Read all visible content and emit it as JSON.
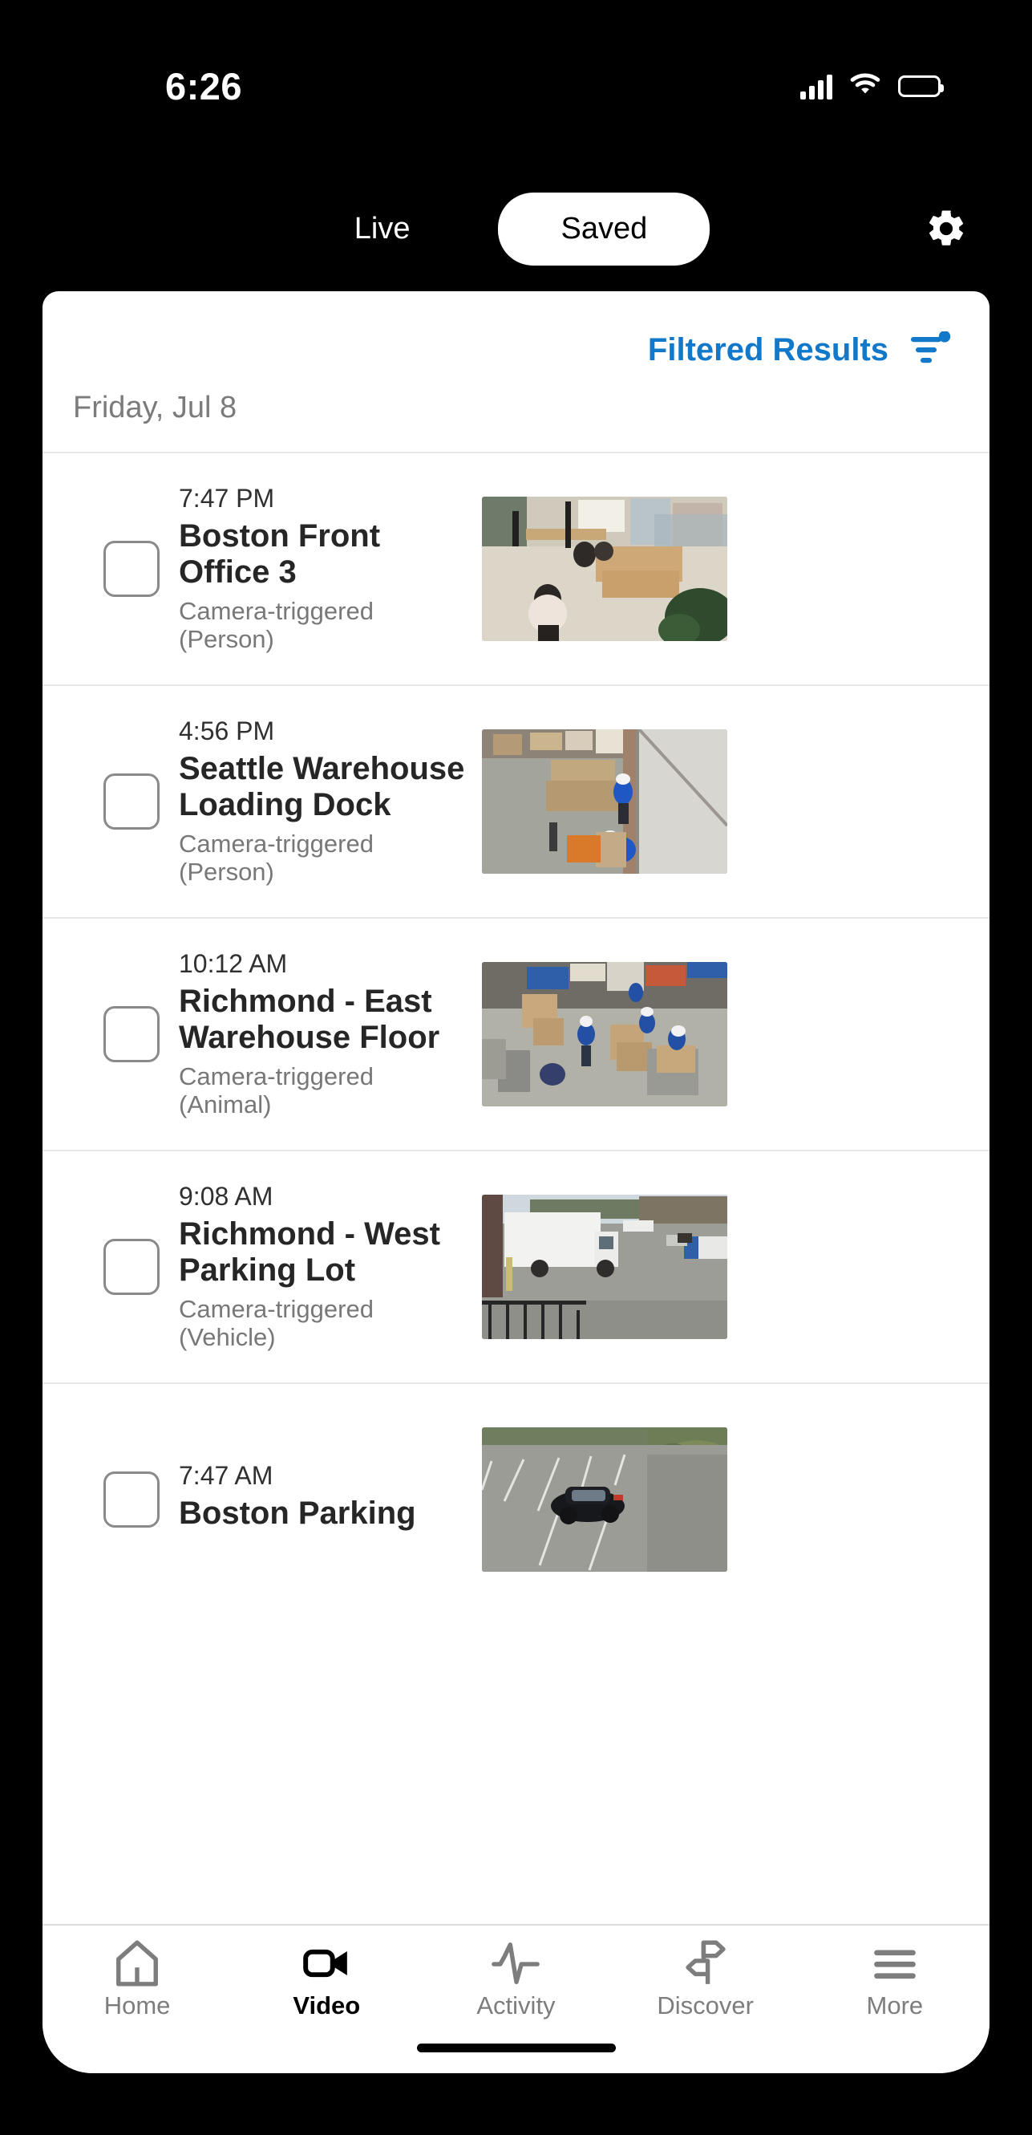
{
  "status_bar": {
    "time": "6:26",
    "cellular_icon": "cellular-signal-icon",
    "wifi_icon": "wifi-icon",
    "battery_icon": "battery-full-icon"
  },
  "top_nav": {
    "live_label": "Live",
    "saved_label": "Saved",
    "active_tab": "Saved",
    "settings_icon": "gear-icon"
  },
  "results_header": {
    "label": "Filtered Results",
    "label_color": "#1278ca",
    "filter_icon": "filter-icon",
    "filter_badge": true
  },
  "date_heading": "Friday, Jul 8",
  "events": [
    {
      "time": "7:47 PM",
      "title": "Boston Front Office 3",
      "subtitle": "Camera-triggered (Person)",
      "thumbnail": "office-interior-thumbnail",
      "checked": false
    },
    {
      "time": "4:56 PM",
      "title": "Seattle Warehouse Loading Dock",
      "subtitle": "Camera-triggered (Person)",
      "thumbnail": "warehouse-loading-dock-thumbnail",
      "checked": false
    },
    {
      "time": "10:12 AM",
      "title": "Richmond - East Warehouse Floor",
      "subtitle": "Camera-triggered (Animal)",
      "thumbnail": "warehouse-floor-thumbnail",
      "checked": false
    },
    {
      "time": "9:08 AM",
      "title": "Richmond - West Parking Lot",
      "subtitle": "Camera-triggered (Vehicle)",
      "thumbnail": "parking-lot-truck-thumbnail",
      "checked": false
    },
    {
      "time": "7:47 AM",
      "title": "Boston Parking",
      "subtitle": "",
      "thumbnail": "parking-lot-car-thumbnail",
      "checked": false
    }
  ],
  "tab_bar": {
    "active": "Video",
    "tabs": [
      {
        "label": "Home",
        "icon": "home-icon"
      },
      {
        "label": "Video",
        "icon": "video-camera-icon"
      },
      {
        "label": "Activity",
        "icon": "activity-pulse-icon"
      },
      {
        "label": "Discover",
        "icon": "discover-icon"
      },
      {
        "label": "More",
        "icon": "hamburger-menu-icon"
      }
    ]
  }
}
